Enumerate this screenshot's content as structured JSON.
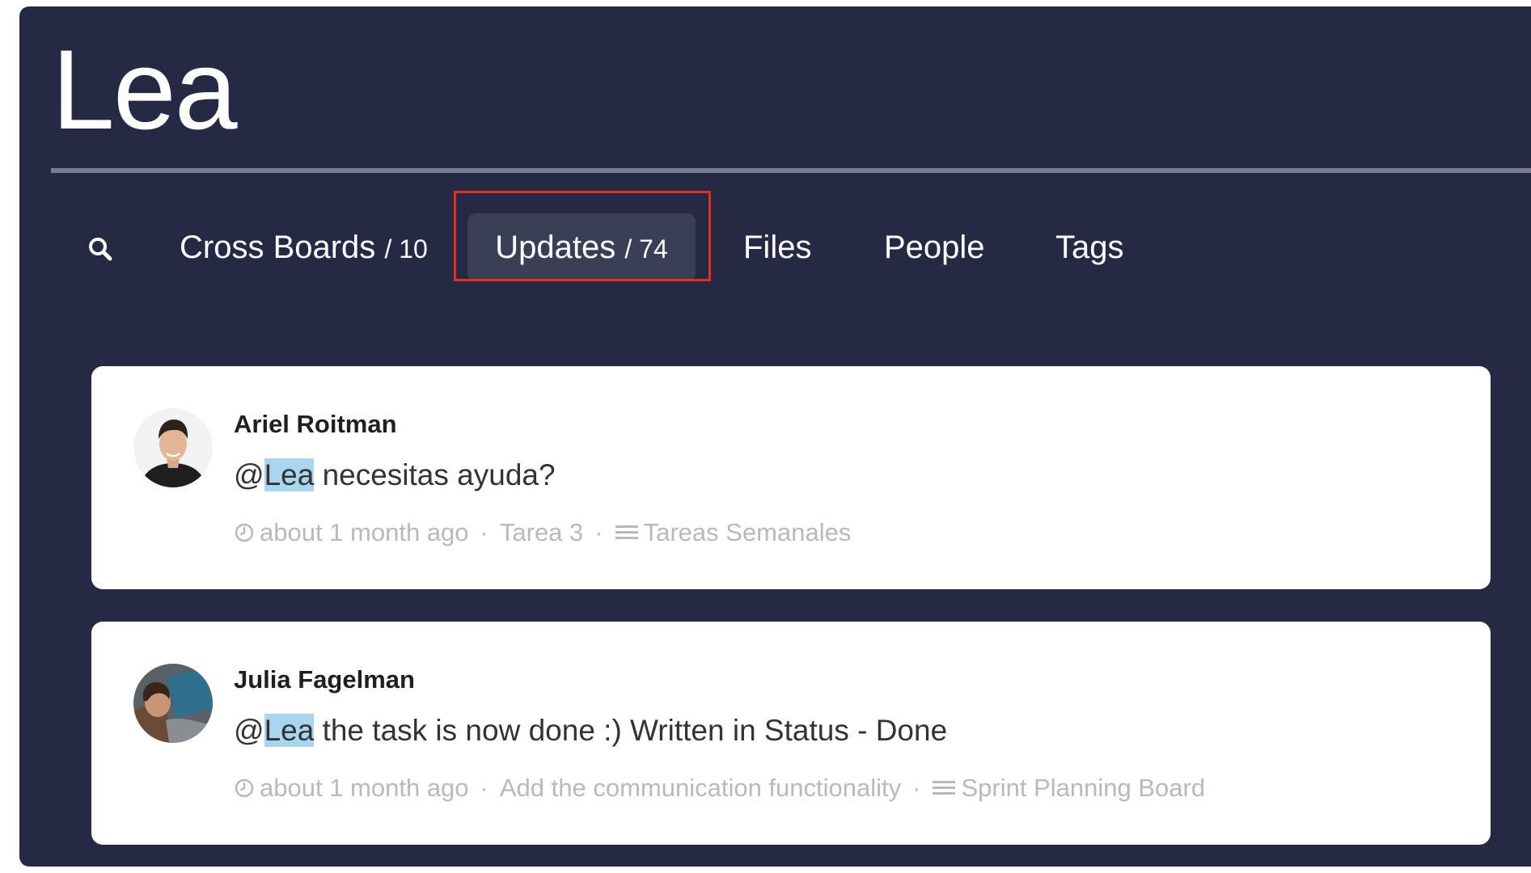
{
  "search": {
    "query": "Lea"
  },
  "tabs": [
    {
      "label": "Cross Boards",
      "count": "/ 10",
      "active": false
    },
    {
      "label": "Updates",
      "count": "/ 74",
      "active": true
    },
    {
      "label": "Files",
      "count": "",
      "active": false
    },
    {
      "label": "People",
      "count": "",
      "active": false
    },
    {
      "label": "Tags",
      "count": "",
      "active": false
    }
  ],
  "icons": {
    "search": "search-icon",
    "clock": "clock-icon",
    "board": "board-list-icon"
  },
  "colors": {
    "panel_bg": "#252943",
    "active_tab_bg": "#3a3e56",
    "highlight_border": "#e4301f",
    "mention_bg": "#a9d6ef"
  },
  "updates": [
    {
      "author": "Ariel Roitman",
      "mention": "@",
      "mention_name": "Lea",
      "text": " necesitas ayuda?",
      "time": "about 1 month ago",
      "item": "Tarea 3",
      "board": "Tareas Semanales",
      "separator": "·"
    },
    {
      "author": "Julia Fagelman",
      "mention": "@",
      "mention_name": "Lea",
      "text": " the task is now done :) Written in Status - Done",
      "time": "about 1 month ago",
      "item": "Add the communication functionality",
      "board": "Sprint Planning Board",
      "separator": "·"
    }
  ]
}
